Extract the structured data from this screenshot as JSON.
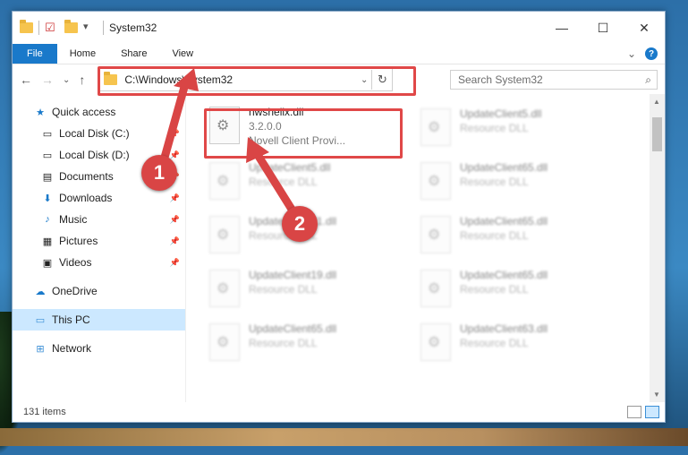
{
  "window": {
    "title": "System32"
  },
  "controls": {
    "minimize": "—",
    "maximize": "☐",
    "close": "✕"
  },
  "ribbon": {
    "tabs": [
      "File",
      "Home",
      "Share",
      "View"
    ],
    "expand": "⌄",
    "help": "?"
  },
  "nav": {
    "back": "←",
    "forward": "→",
    "recent": "⌄",
    "up": "↑"
  },
  "address": {
    "path": "C:\\Windows\\System32",
    "chevron": "⌄",
    "refresh": "↻"
  },
  "search": {
    "placeholder": "Search System32",
    "icon": "⌕"
  },
  "sidebar": {
    "items": [
      {
        "label": "Quick access",
        "icon": "star-icon",
        "glyph": "★",
        "color": "#1979ca"
      },
      {
        "label": "Local Disk (C:)",
        "icon": "drive-icon",
        "glyph": "▭",
        "pinned": true
      },
      {
        "label": "Local Disk (D:)",
        "icon": "drive-icon",
        "glyph": "▭",
        "pinned": true
      },
      {
        "label": "Documents",
        "icon": "documents-icon",
        "glyph": "▤",
        "pinned": true
      },
      {
        "label": "Downloads",
        "icon": "download-icon",
        "glyph": "⬇",
        "color": "#1979ca",
        "pinned": true
      },
      {
        "label": "Music",
        "icon": "music-icon",
        "glyph": "♪",
        "color": "#1979ca",
        "pinned": true
      },
      {
        "label": "Pictures",
        "icon": "pictures-icon",
        "glyph": "▦",
        "pinned": true
      },
      {
        "label": "Videos",
        "icon": "videos-icon",
        "glyph": "▣",
        "pinned": true
      },
      {
        "label": "OneDrive",
        "icon": "cloud-icon",
        "glyph": "☁",
        "color": "#1979ca"
      },
      {
        "label": "This PC",
        "icon": "computer-icon",
        "glyph": "▭",
        "color": "#3b8fd6",
        "selected": true
      },
      {
        "label": "Network",
        "icon": "network-icon",
        "glyph": "⊞",
        "color": "#3b8fd6"
      }
    ],
    "pin_glyph": "📌"
  },
  "files": {
    "highlighted": {
      "name": "nwshellx.dll",
      "version": "3.2.0.0",
      "description": "Novell Client Provi..."
    },
    "left_column": [
      {
        "name": "UpdateClient5.dll",
        "type": "Resource DLL"
      },
      {
        "name": "UpdateClient21.dll",
        "type": "Resource DLL"
      },
      {
        "name": "UpdateClient19.dll",
        "type": "Resource DLL"
      },
      {
        "name": "UpdateClient65.dll",
        "type": "Resource DLL"
      }
    ],
    "right_column": [
      {
        "name": "UpdateClient5.dll",
        "type": "Resource DLL"
      },
      {
        "name": "UpdateClient65.dll",
        "type": "Resource DLL"
      },
      {
        "name": "UpdateClient65.dll",
        "type": "Resource DLL"
      },
      {
        "name": "UpdateClient65.dll",
        "type": "Resource DLL"
      },
      {
        "name": "UpdateClient63.dll",
        "type": "Resource DLL"
      }
    ]
  },
  "status": {
    "count": "131 items"
  },
  "callouts": [
    "1",
    "2"
  ],
  "colors": {
    "accent": "#1979ca",
    "highlight": "#e04848",
    "callout": "#d94545",
    "selected": "#cce8ff"
  }
}
